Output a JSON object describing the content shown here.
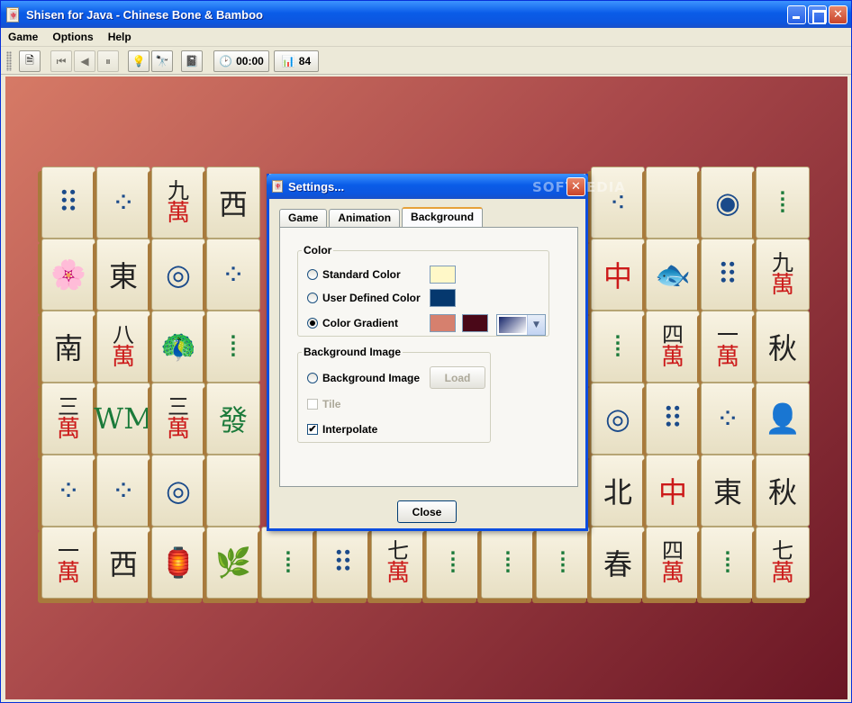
{
  "window": {
    "title": "Shisen for Java - Chinese Bone & Bamboo",
    "app_icon": "🀄"
  },
  "menu": [
    "Game",
    "Options",
    "Help"
  ],
  "toolbar": {
    "timer": "00:00",
    "tiles_left": "84"
  },
  "tiles": [
    [
      "⠿",
      "⁘",
      "九\n萬",
      "西",
      "",
      "",
      "",
      "",
      "",
      "",
      "⁖",
      "",
      "◉",
      "⦙"
    ],
    [
      "🌸",
      "東",
      "◎",
      "⁘",
      "",
      "",
      "",
      "",
      "",
      "",
      "中",
      "🐟",
      "⠿",
      "九\n萬"
    ],
    [
      "南",
      "八\n萬",
      "🦚",
      "⦙",
      "",
      "",
      "",
      "",
      "",
      "",
      "⦙",
      "四\n萬",
      "一\n萬",
      "秋"
    ],
    [
      "三\n萬",
      "WM",
      "三\n萬",
      "發",
      "",
      "",
      "",
      "",
      "",
      "",
      "◎",
      "⠿",
      "⁘",
      "👤"
    ],
    [
      "⁘",
      "⁘",
      "◎",
      "",
      "",
      "",
      "",
      "",
      "",
      "",
      "北",
      "中",
      "東",
      "秋"
    ],
    [
      "一\n萬",
      "西",
      "🏮",
      "🌿",
      "⦙",
      "⠿",
      "七\n萬",
      "⦙",
      "⦙",
      "⦙",
      "春",
      "四\n萬",
      "⦙",
      "七\n萬"
    ]
  ],
  "dialog": {
    "title": "Settings...",
    "watermark": "SOFTPEDIA",
    "tabs": [
      "Game",
      "Animation",
      "Background"
    ],
    "color_group": {
      "legend": "Color",
      "standard_label": "Standard Color",
      "user_label": "User Defined Color",
      "gradient_label": "Color Gradient",
      "standard_color": "#fff8c8",
      "user_color": "#05386e",
      "gradient_color_1": "#d6806e",
      "gradient_color_2": "#4a0818"
    },
    "bg_group": {
      "legend": "Background Image",
      "image_label": "Background Image",
      "load_label": "Load",
      "tile_label": "Tile",
      "interpolate_label": "Interpolate"
    },
    "close_label": "Close"
  }
}
